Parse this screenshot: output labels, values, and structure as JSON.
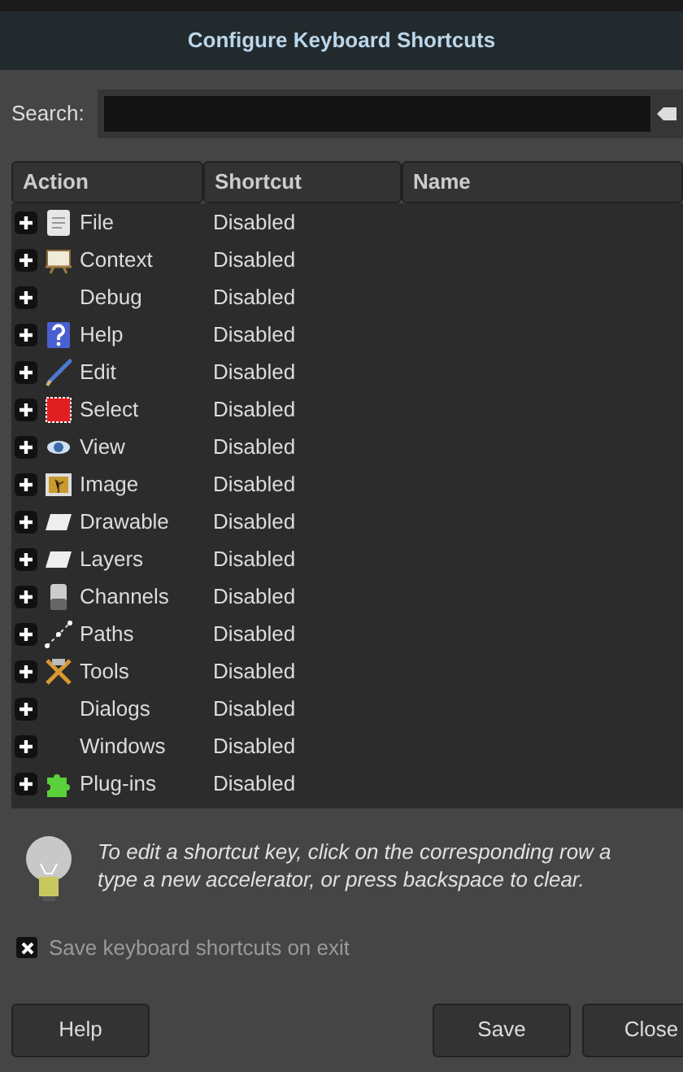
{
  "window": {
    "title": "Configure Keyboard Shortcuts"
  },
  "search": {
    "label": "Search:"
  },
  "table": {
    "columns": [
      "Action",
      "Shortcut",
      "Name"
    ],
    "rows": [
      {
        "action": "File",
        "shortcut": "Disabled",
        "expanded": false
      },
      {
        "action": "Context",
        "shortcut": "Disabled",
        "expanded": false
      },
      {
        "action": "Debug",
        "shortcut": "Disabled",
        "expanded": false
      },
      {
        "action": "Help",
        "shortcut": "Disabled",
        "expanded": false
      },
      {
        "action": "Edit",
        "shortcut": "Disabled",
        "expanded": false
      },
      {
        "action": "Select",
        "shortcut": "Disabled",
        "expanded": false
      },
      {
        "action": "View",
        "shortcut": "Disabled",
        "expanded": false
      },
      {
        "action": "Image",
        "shortcut": "Disabled",
        "expanded": false
      },
      {
        "action": "Drawable",
        "shortcut": "Disabled",
        "expanded": false
      },
      {
        "action": "Layers",
        "shortcut": "Disabled",
        "expanded": false
      },
      {
        "action": "Channels",
        "shortcut": "Disabled",
        "expanded": false
      },
      {
        "action": "Paths",
        "shortcut": "Disabled",
        "expanded": false
      },
      {
        "action": "Tools",
        "shortcut": "Disabled",
        "expanded": false
      },
      {
        "action": "Dialogs",
        "shortcut": "Disabled",
        "expanded": false
      },
      {
        "action": "Windows",
        "shortcut": "Disabled",
        "expanded": false
      },
      {
        "action": "Plug-ins",
        "shortcut": "Disabled",
        "expanded": false
      }
    ]
  },
  "hint": {
    "lines": [
      "To edit a shortcut key, click on the corresponding row a",
      "type a new accelerator, or press backspace to clear."
    ]
  },
  "save_on_exit": {
    "label": "Save keyboard shortcuts on exit",
    "checked": true
  },
  "buttons": [
    "Help",
    "Save",
    "Close"
  ]
}
